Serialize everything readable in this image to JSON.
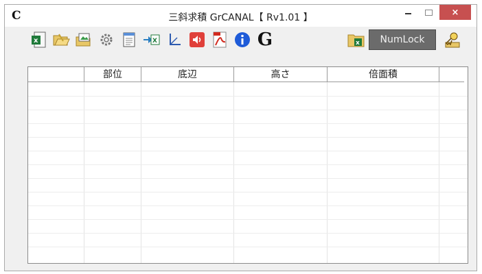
{
  "window": {
    "app_icon": "C",
    "title": "三斜求積 GrCANAL【 Rv1.01 】",
    "close_glyph": "×"
  },
  "toolbar": {
    "buttons": [
      {
        "name": "excel-icon"
      },
      {
        "name": "open-folder-icon"
      },
      {
        "name": "image-folder-icon"
      },
      {
        "name": "gear-icon"
      },
      {
        "name": "notepad-icon"
      },
      {
        "name": "export-excel-icon"
      },
      {
        "name": "axis-icon"
      },
      {
        "name": "speaker-icon"
      },
      {
        "name": "pdf-icon"
      },
      {
        "name": "info-icon"
      },
      {
        "name": "g-icon",
        "glyph": "G"
      },
      {
        "name": "excel-folder-icon"
      },
      {
        "name": "key-icon"
      }
    ],
    "numlock_label": "NumLock"
  },
  "grid": {
    "columns": [
      "",
      "部位",
      "底辺",
      "高さ",
      "倍面積",
      ""
    ],
    "rows": []
  },
  "colors": {
    "close": "#c75050",
    "numlock_bg": "#6b6b6b",
    "info_blue": "#1e5bd8",
    "excel_green": "#1f7a3a",
    "pdf_red": "#d22b1f",
    "speaker_red": "#e0403a"
  }
}
